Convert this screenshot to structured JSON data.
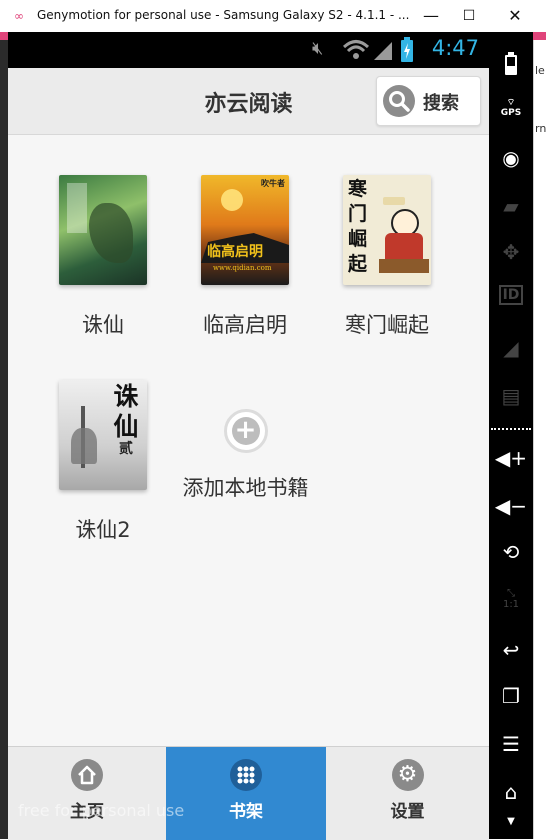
{
  "window": {
    "title": "Genymotion for personal use - Samsung Galaxy S2 - 4.1.1 - ...",
    "controls": {
      "minimize": "—",
      "maximize": "☐",
      "close": "✕"
    }
  },
  "status_bar": {
    "clock": "4:47"
  },
  "app": {
    "title": "亦云阅读",
    "search_label": "搜索"
  },
  "books": [
    {
      "title": "诛仙"
    },
    {
      "title": "临高启明",
      "cover_text": "临高启明",
      "publisher_mark": "吹牛者",
      "url": "www.qidian.com"
    },
    {
      "title": "寒门崛起",
      "cover_text": "寒门崛起"
    },
    {
      "title": "诛仙2",
      "cover_text": "诛仙",
      "cover_sub": "贰"
    }
  ],
  "add_local": {
    "label": "添加本地书籍"
  },
  "bottom_nav": {
    "tabs": [
      {
        "label": "主页",
        "active": false
      },
      {
        "label": "书架",
        "active": true
      },
      {
        "label": "设置",
        "active": false
      }
    ]
  },
  "watermark": "free for personal use",
  "toolbar": {
    "gps_label": "GPS",
    "id_label": "ID",
    "scale_label": "1:1"
  },
  "colors": {
    "accent": "#33b5e5",
    "active_tab": "#3189d1",
    "window_accent": "#e0457b"
  }
}
